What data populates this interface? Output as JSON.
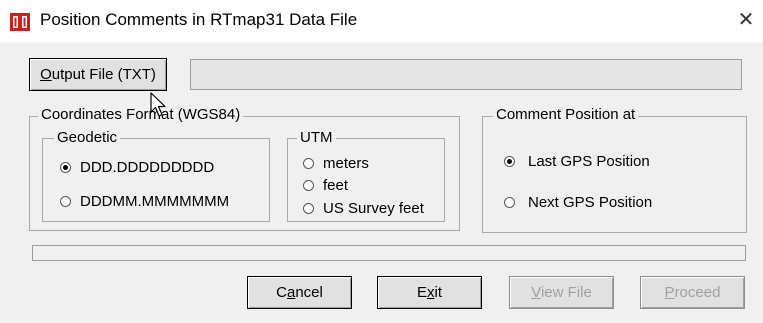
{
  "window": {
    "title": "Position Comments in RTmap31 Data File",
    "close_glyph": "✕"
  },
  "output_file": {
    "button_label_u": "O",
    "button_label_rest": "utput File (TXT)",
    "path_value": ""
  },
  "coordinates_format": {
    "label": "Coordinates Format (WGS84)",
    "geodetic": {
      "label": "Geodetic",
      "options": [
        {
          "label": "DDD.DDDDDDDDD",
          "selected": true
        },
        {
          "label": "DDDMM.MMMMMMM",
          "selected": false
        }
      ]
    },
    "utm": {
      "label": "UTM",
      "options": [
        {
          "label": "meters",
          "selected": false
        },
        {
          "label": "feet",
          "selected": false
        },
        {
          "label": "US Survey feet",
          "selected": false
        }
      ]
    }
  },
  "comment_position": {
    "label": "Comment Position at",
    "options": [
      {
        "label": "Last GPS Position",
        "selected": true
      },
      {
        "label": "Next GPS Position",
        "selected": false
      }
    ]
  },
  "progress": {
    "value": 0
  },
  "buttons": {
    "cancel": {
      "pre": "C",
      "u": "a",
      "post": "ncel"
    },
    "exit": {
      "pre": "E",
      "u": "x",
      "post": "it"
    },
    "view_file": {
      "pre": "",
      "u": "V",
      "post": "iew File"
    },
    "proceed": {
      "pre": "",
      "u": "P",
      "post": "roceed"
    }
  },
  "colors": {
    "app_icon_red": "#cc1f1f",
    "disabled_text": "#a0a0a0"
  },
  "icons": {
    "app": "app-icon",
    "close": "close-icon",
    "cursor": "mouse-pointer-icon"
  }
}
